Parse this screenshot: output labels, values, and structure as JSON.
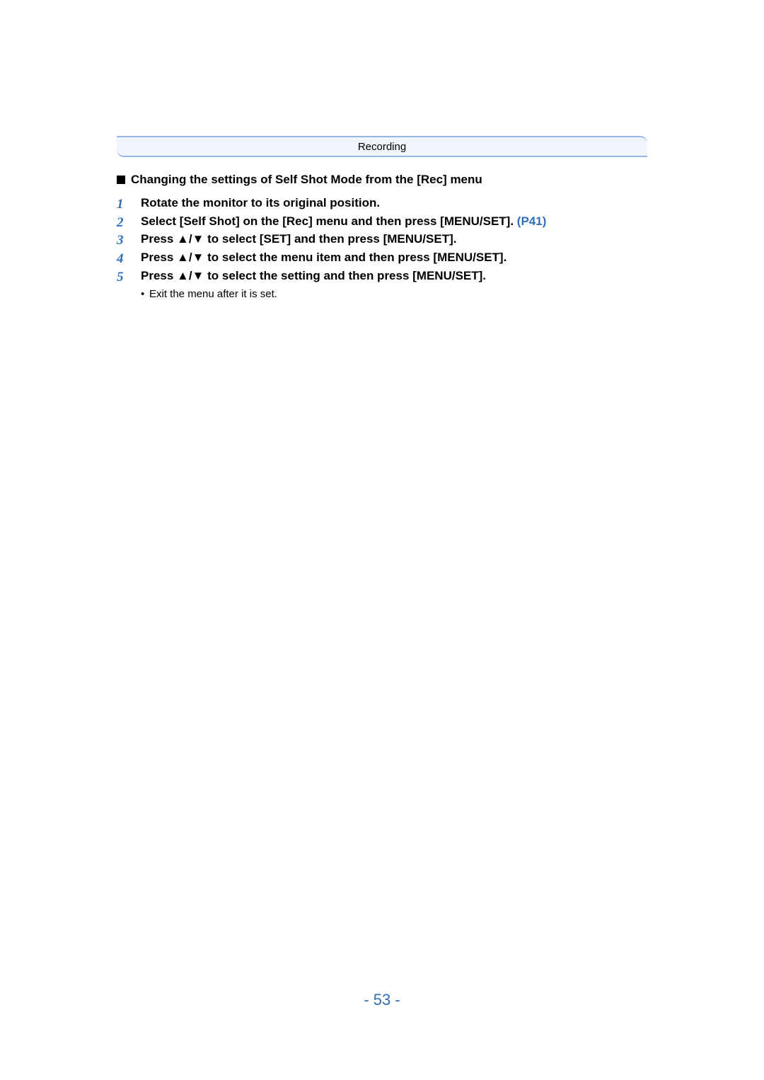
{
  "header": {
    "label": "Recording"
  },
  "section": {
    "heading": "Changing the settings of Self Shot Mode from the [Rec] menu"
  },
  "steps": [
    {
      "num": "1",
      "text": "Rotate the monitor to its original position."
    },
    {
      "num": "2",
      "text": "Select [Self Shot] on the [Rec] menu and then press [MENU/SET]. ",
      "ref": "(P41)"
    },
    {
      "num": "3",
      "text": "Press ▲/▼ to select [SET] and then press [MENU/SET]."
    },
    {
      "num": "4",
      "text": "Press ▲/▼ to select the menu item and then press [MENU/SET]."
    },
    {
      "num": "5",
      "text": "Press ▲/▼ to select the setting and then press [MENU/SET]."
    }
  ],
  "sub_bullet": {
    "text": "Exit the menu after it is set."
  },
  "page_number": "- 53 -"
}
